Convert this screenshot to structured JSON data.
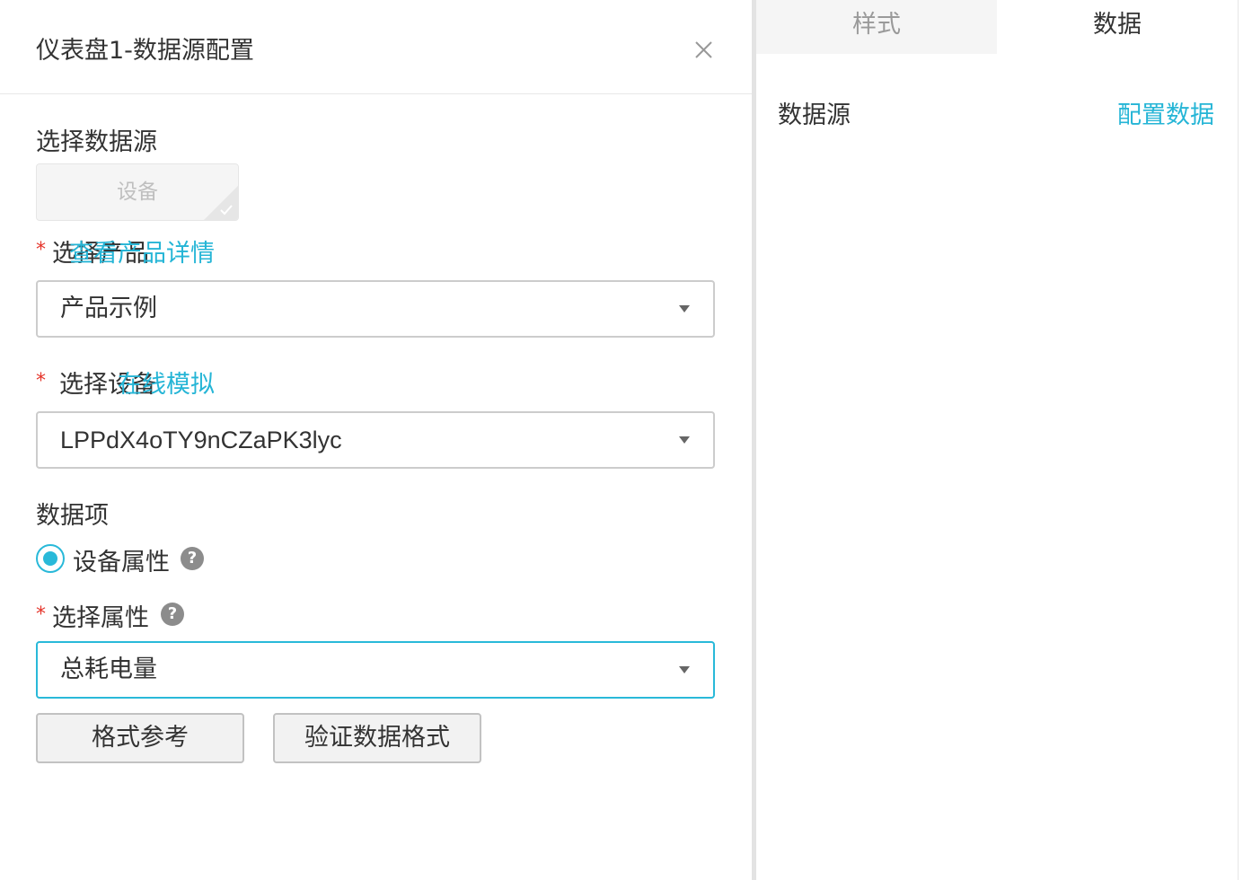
{
  "dialog": {
    "title": "仪表盘1-数据源配置"
  },
  "form": {
    "source": {
      "label": "选择数据源",
      "chip_label": "设备"
    },
    "product": {
      "required_mark": "*",
      "label": "选择产品",
      "link": "查看产品详情",
      "value": "产品示例"
    },
    "device": {
      "required_mark": "*",
      "label": "选择设备",
      "link": "在线模拟",
      "value": "LPPdX4oTY9nCZaPK3lyc"
    },
    "data_item": {
      "label": "数据项",
      "option_label": "设备属性",
      "help": "?"
    },
    "property": {
      "required_mark": "*",
      "label": "选择属性",
      "help": "?",
      "value": "总耗电量"
    },
    "buttons": {
      "format_ref": "格式参考",
      "validate": "验证数据格式"
    }
  },
  "panel": {
    "tabs": [
      {
        "label": "样式"
      },
      {
        "label": "数据"
      }
    ],
    "data_source_label": "数据源",
    "config_link": "配置数据"
  },
  "colors": {
    "accent": "#25b5d6",
    "required": "#e5352b"
  }
}
